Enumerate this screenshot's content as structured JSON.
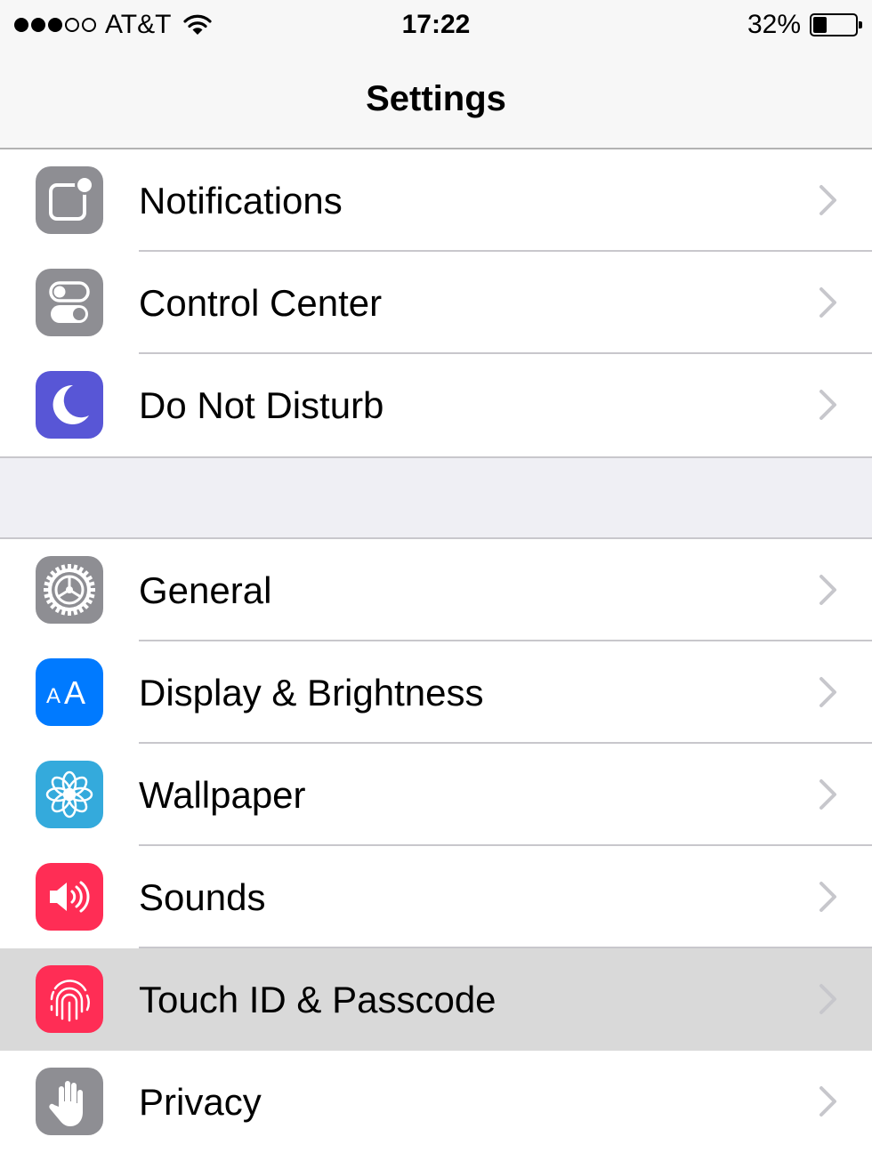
{
  "status_bar": {
    "carrier": "AT&T",
    "signal_strength": 3,
    "signal_max": 5,
    "time": "17:22",
    "battery_percent": "32%",
    "battery_level": 0.32
  },
  "nav": {
    "title": "Settings"
  },
  "colors": {
    "gray_icon": "#8e8e93",
    "purple_icon": "#5856d6",
    "blue_icon": "#007aff",
    "cyan_icon": "#34aadc",
    "red_icon": "#ff2d55",
    "chevron": "#c7c7cc",
    "group_background": "#efeff4"
  },
  "groups": [
    {
      "items": [
        {
          "label": "Notifications",
          "icon": "notifications-icon",
          "color": "#8e8e93"
        },
        {
          "label": "Control Center",
          "icon": "control-center-icon",
          "color": "#8e8e93"
        },
        {
          "label": "Do Not Disturb",
          "icon": "moon-icon",
          "color": "#5856d6"
        }
      ]
    },
    {
      "items": [
        {
          "label": "General",
          "icon": "gear-icon",
          "color": "#8e8e93"
        },
        {
          "label": "Display & Brightness",
          "icon": "text-size-icon",
          "color": "#007aff"
        },
        {
          "label": "Wallpaper",
          "icon": "flower-icon",
          "color": "#34aadc"
        },
        {
          "label": "Sounds",
          "icon": "speaker-icon",
          "color": "#ff2d55"
        },
        {
          "label": "Touch ID & Passcode",
          "icon": "fingerprint-icon",
          "color": "#ff2d55",
          "highlighted": true
        },
        {
          "label": "Privacy",
          "icon": "hand-icon",
          "color": "#8e8e93"
        }
      ]
    }
  ]
}
